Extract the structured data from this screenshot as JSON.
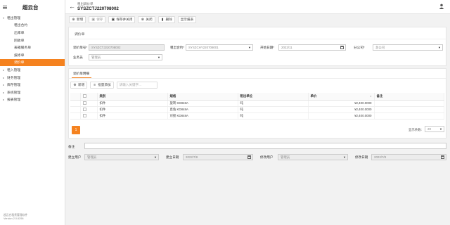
{
  "app": {
    "title": "超云台"
  },
  "sidebar": {
    "items": [
      {
        "label": "租出管理",
        "level": 0,
        "expanded": true,
        "active": false
      },
      {
        "label": "租出合约",
        "level": 1,
        "active": false
      },
      {
        "label": "出库单",
        "level": 1,
        "active": false
      },
      {
        "label": "回收单",
        "level": 1,
        "active": false
      },
      {
        "label": "表箱服务单",
        "level": 1,
        "active": false
      },
      {
        "label": "报修单",
        "level": 1,
        "active": false
      },
      {
        "label": "调价单",
        "level": 1,
        "active": true
      },
      {
        "label": "租入管理",
        "level": 0,
        "expanded": false,
        "active": false
      },
      {
        "label": "财务管理",
        "level": 0,
        "expanded": false,
        "active": false
      },
      {
        "label": "库存管理",
        "level": 0,
        "expanded": false,
        "active": false
      },
      {
        "label": "系统管理",
        "level": 0,
        "expanded": false,
        "active": false
      },
      {
        "label": "报表管理",
        "level": 0,
        "expanded": false,
        "active": false
      }
    ],
    "footer_line1": "超云台租赁管理软件",
    "footer_line2": "Version 2.0.6296"
  },
  "header": {
    "breadcrumb": "租出调价单",
    "doc_no": "SYSZCTJ220708002"
  },
  "toolbar": {
    "new": "新增",
    "save": "保存",
    "save_close": "保存并关闭",
    "close": "关闭",
    "delete": "删除",
    "show_report": "显示报表"
  },
  "form": {
    "section_title": "调价单",
    "adjust_no_label": "调价单号*",
    "adjust_no": "SYSZCTJ220708002",
    "contract_label": "租出合约*",
    "contract": "SYSZCHY220708001",
    "start_date_label": "开始日期*",
    "start_date": "2022/11",
    "branch_label": "分公司*",
    "branch": "总公司",
    "salesman_label": "业务员",
    "salesman": "管理员"
  },
  "tabs": {
    "detail": "调价单明细"
  },
  "grid": {
    "new": "新增",
    "batch_add": "批量添加",
    "search_placeholder": "请输入关键字...",
    "headers": {
      "category": "类别",
      "spec": "规格",
      "unit": "租出单位",
      "price": "单价",
      "note": "备注"
    },
    "rows": [
      {
        "category": "扣件",
        "spec": "旋转 KD848A",
        "unit": "吨",
        "price": "¥2,400.0000",
        "note": ""
      },
      {
        "category": "扣件",
        "spec": "直角 KD848A",
        "unit": "吨",
        "price": "¥2,400.0000",
        "note": ""
      },
      {
        "category": "扣件",
        "spec": "对接 KD848A",
        "unit": "吨",
        "price": "¥2,400.0000",
        "note": ""
      }
    ],
    "page": "1",
    "page_size_label": "显示条数:",
    "page_size": "20"
  },
  "footer_form": {
    "note_label": "备注",
    "created_by_label": "建立用户",
    "created_by": "管理员",
    "created_date_label": "建立日期",
    "created_date": "2022/7/8",
    "modified_by_label": "修改用户",
    "modified_by": "管理员",
    "modified_date_label": "修改日期",
    "modified_date": "2022/7/8"
  },
  "colors": {
    "accent": "#f5821f"
  }
}
